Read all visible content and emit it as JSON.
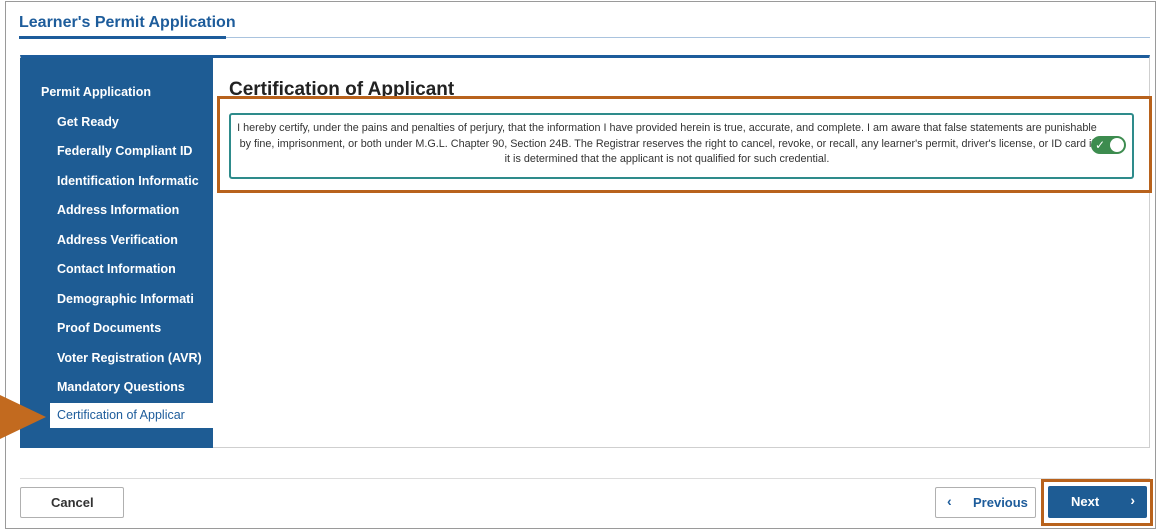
{
  "header": {
    "title": "Learner's Permit Application"
  },
  "sidebar": {
    "heading": "Permit Application",
    "items": [
      {
        "label": "Get Ready"
      },
      {
        "label": "Federally Compliant ID"
      },
      {
        "label": "Identification Informatic"
      },
      {
        "label": "Address Information"
      },
      {
        "label": "Address Verification"
      },
      {
        "label": "Contact Information"
      },
      {
        "label": "Demographic Informati"
      },
      {
        "label": "Proof Documents"
      },
      {
        "label": "Voter Registration (AVR)"
      },
      {
        "label": "Mandatory Questions"
      },
      {
        "label": "Certification of Applicar",
        "active": true
      }
    ]
  },
  "main": {
    "section_title": "Certification of Applicant",
    "certification_text": "I hereby certify, under the pains and penalties of perjury, that the information I have provided herein is true, accurate, and complete. I am aware that false statements are punishable by fine, imprisonment, or both under M.G.L. Chapter 90, Section 24B. The Registrar reserves the right to cancel, revoke, or recall, any learner's permit, driver's license, or ID card if it is determined that the applicant is not qualified for such credential.",
    "certify_toggle_on": true
  },
  "footer": {
    "cancel_label": "Cancel",
    "previous_label": "Previous",
    "next_label": "Next"
  },
  "colors": {
    "primary": "#1e5c94",
    "highlight": "#b8621c",
    "toggle_on": "#3d8c4f",
    "cert_border": "#2e8b8b"
  },
  "icons": {
    "previous": "chevron-left-icon",
    "next": "chevron-right-icon",
    "toggle": "check-icon"
  }
}
